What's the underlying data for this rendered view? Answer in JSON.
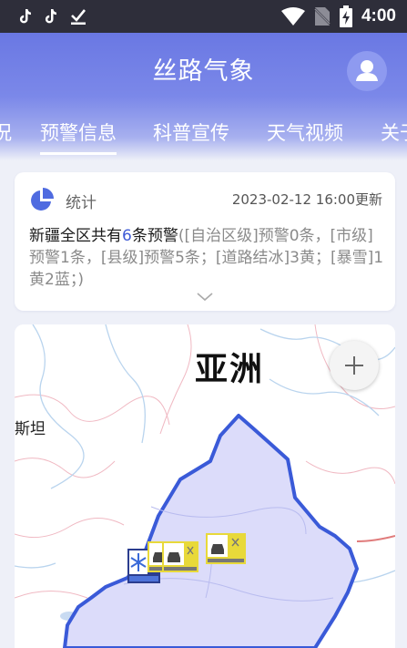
{
  "status_bar": {
    "time": "4:00",
    "left_icons": [
      "tiktok-icon",
      "tiktok-icon",
      "download-done-icon"
    ],
    "right_icons": [
      "wifi-icon",
      "no-sim-icon",
      "battery-charging-icon"
    ]
  },
  "header": {
    "title": "丝路气象",
    "avatar_icon": "user-avatar-icon",
    "background_color": "#6a78e3"
  },
  "tabs": [
    {
      "label": "况",
      "active": false
    },
    {
      "label": "预警信息",
      "active": true
    },
    {
      "label": "科普宣传",
      "active": false
    },
    {
      "label": "天气视频",
      "active": false
    },
    {
      "label": "关于",
      "active": false
    }
  ],
  "stats_card": {
    "icon": "pie-chart-icon",
    "label": "统计",
    "updated": "2023-02-12 16:00更新",
    "summary_prefix": "新疆全区共有",
    "summary_count": "6",
    "summary_suffix": "条预警",
    "summary_detail": "([自治区级]预警0条，[市级]预警1条，[县级]预警5条；[道路结冰]3黄；[暴雪]1黄2蓝；)",
    "expand_icon": "chevron-down-icon",
    "accent_color": "#3f5bd6"
  },
  "map": {
    "region_label": "亚洲",
    "place_label": "斯坦",
    "zoom_in_icon": "plus-icon",
    "region_fill": "#dcdcfa",
    "border_color": "#3a5ad8",
    "markers": [
      {
        "type": "blizzard",
        "level": "blue"
      },
      {
        "type": "road-icing",
        "level": "yellow"
      },
      {
        "type": "road-icing",
        "level": "yellow"
      },
      {
        "type": "road-icing",
        "level": "yellow"
      }
    ]
  }
}
